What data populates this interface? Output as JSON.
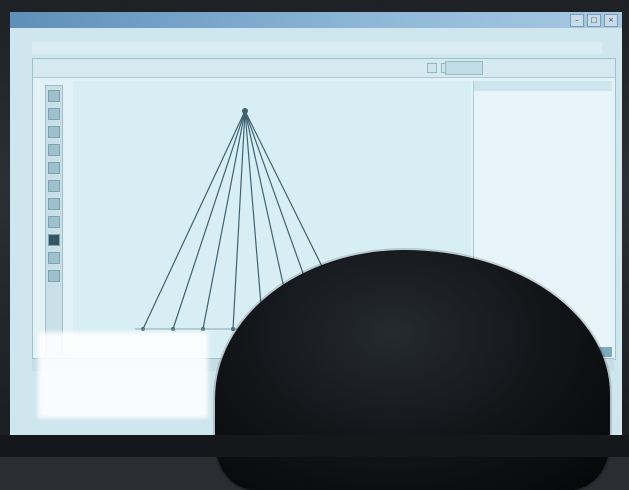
{
  "window": {
    "title": "",
    "controls": [
      "–",
      "□",
      "×"
    ]
  },
  "menu": {
    "items": [
      "",
      "",
      "",
      "",
      ""
    ]
  },
  "toolbar": {
    "tab_label": ""
  },
  "tree": {
    "root_label": "",
    "leaf_count": 8
  },
  "panel": {
    "title": "",
    "rows": [
      "",
      "",
      "",
      "",
      "",
      "",
      "",
      "",
      "",
      "",
      "",
      "",
      "",
      "",
      "",
      "",
      ""
    ]
  }
}
